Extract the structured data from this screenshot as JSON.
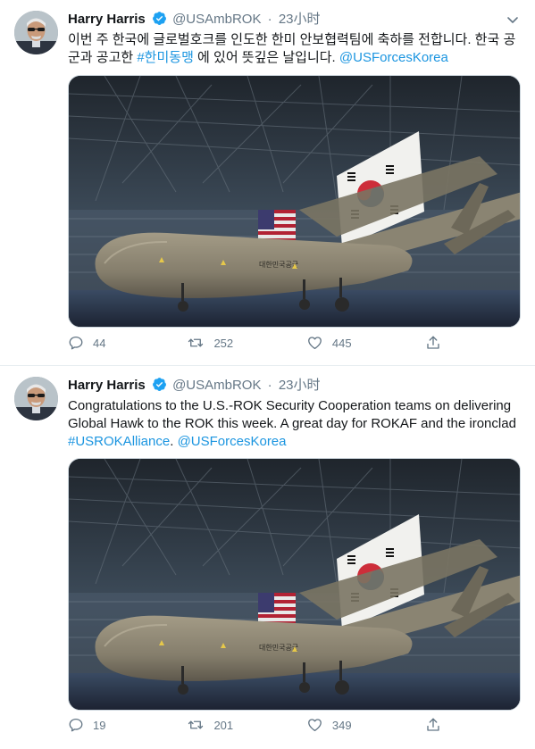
{
  "tweets": [
    {
      "author": {
        "name": "Harry Harris",
        "handle": "@USAmbROK",
        "verified": true
      },
      "separator": "·",
      "timestamp": "23小时",
      "text_parts": [
        {
          "text": "이번 주 한국에 글로벌호크를 인도한 한미 안보협력팀에 축하를 전합니다. 한국 공군과 공고한 ",
          "link": false
        },
        {
          "text": "#한미동맹",
          "link": true
        },
        {
          "text": " 에 있어 뜻깊은 날입니다. ",
          "link": false
        },
        {
          "text": "@USForcesKorea",
          "link": true
        }
      ],
      "image": {
        "icon": "photo-global-hawk-drone-in-hangar",
        "fuselage_text": "대한민국공군"
      },
      "replies": "44",
      "retweets": "252",
      "likes": "445"
    },
    {
      "author": {
        "name": "Harry Harris",
        "handle": "@USAmbROK",
        "verified": true
      },
      "separator": "·",
      "timestamp": "23小时",
      "text_parts": [
        {
          "text": "Congratulations to the U.S.-ROK Security Cooperation teams on delivering Global Hawk to the ROK this week. A great day for ROKAF and the ironclad ",
          "link": false
        },
        {
          "text": "#USROKAlliance",
          "link": true
        },
        {
          "text": ". ",
          "link": false
        },
        {
          "text": "@USForcesKorea",
          "link": true
        }
      ],
      "image": {
        "icon": "photo-global-hawk-drone-in-hangar",
        "fuselage_text": "대한민국공군"
      },
      "replies": "19",
      "retweets": "201",
      "likes": "349"
    }
  ],
  "colors": {
    "link": "#1b95e0",
    "muted": "#657786",
    "verified": "#1da1f2",
    "divider": "#e6ecf0"
  }
}
